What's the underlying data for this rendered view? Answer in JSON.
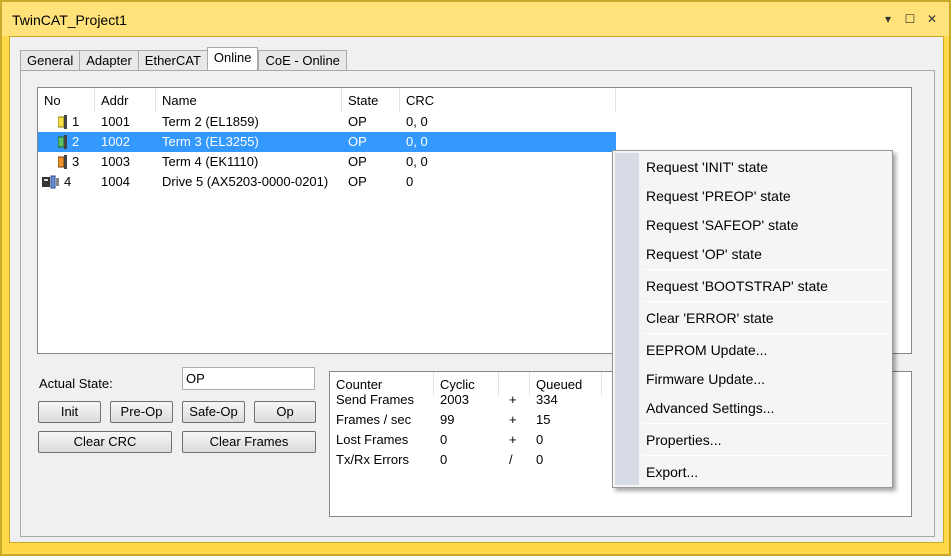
{
  "window": {
    "title": "TwinCAT_Project1",
    "controls": [
      "▾",
      "☐",
      "✕"
    ]
  },
  "tabs": [
    {
      "label": "General",
      "active": false
    },
    {
      "label": "Adapter",
      "active": false
    },
    {
      "label": "EtherCAT",
      "active": false
    },
    {
      "label": "Online",
      "active": true
    },
    {
      "label": "CoE - Online",
      "active": false
    }
  ],
  "device_list": {
    "columns": [
      "No",
      "Addr",
      "Name",
      "State",
      "CRC"
    ],
    "rows": [
      {
        "no": "1",
        "addr": "1001",
        "name": "Term 2 (EL1859)",
        "state": "OP",
        "crc": "0, 0",
        "icon": "yellow-terminal-icon",
        "selected": false
      },
      {
        "no": "2",
        "addr": "1002",
        "name": "Term 3 (EL3255)",
        "state": "OP",
        "crc": "0, 0",
        "icon": "green-terminal-icon",
        "selected": true
      },
      {
        "no": "3",
        "addr": "1003",
        "name": "Term 4 (EK1110)",
        "state": "OP",
        "crc": "0, 0",
        "icon": "orange-terminal-icon",
        "selected": false
      },
      {
        "no": "4",
        "addr": "1004",
        "name": "Drive 5 (AX5203-0000-0201)",
        "state": "OP",
        "crc": "0",
        "icon": "drive-icon",
        "selected": false
      }
    ]
  },
  "state_panel": {
    "actual_state_label": "Actual State:",
    "actual_state_value": "OP",
    "buttons": {
      "init": "Init",
      "preop": "Pre-Op",
      "safeop": "Safe-Op",
      "op": "Op",
      "clear_crc": "Clear CRC",
      "clear_frames": "Clear Frames"
    }
  },
  "counters": {
    "columns": [
      "Counter",
      "Cyclic",
      "",
      "Queued"
    ],
    "rows": [
      {
        "counter": "Send Frames",
        "cyclic": "2003",
        "op": "+",
        "queued": "334"
      },
      {
        "counter": "Frames / sec",
        "cyclic": "99",
        "op": "+",
        "queued": "15"
      },
      {
        "counter": "Lost Frames",
        "cyclic": "0",
        "op": "+",
        "queued": "0"
      },
      {
        "counter": "Tx/Rx Errors",
        "cyclic": "0",
        "op": "/",
        "queued": "0"
      }
    ]
  },
  "context_menu": {
    "items": [
      "Request 'INIT' state",
      "Request 'PREOP' state",
      "Request 'SAFEOP' state",
      "Request 'OP' state",
      "Request 'BOOTSTRAP' state",
      "Clear 'ERROR' state",
      "EEPROM Update...",
      "Firmware Update...",
      "Advanced Settings...",
      "Properties...",
      "Export..."
    ]
  },
  "colors": {
    "title_bar": "#ffe27a",
    "frame": "#ffd84a",
    "selection": "#3399ff"
  }
}
